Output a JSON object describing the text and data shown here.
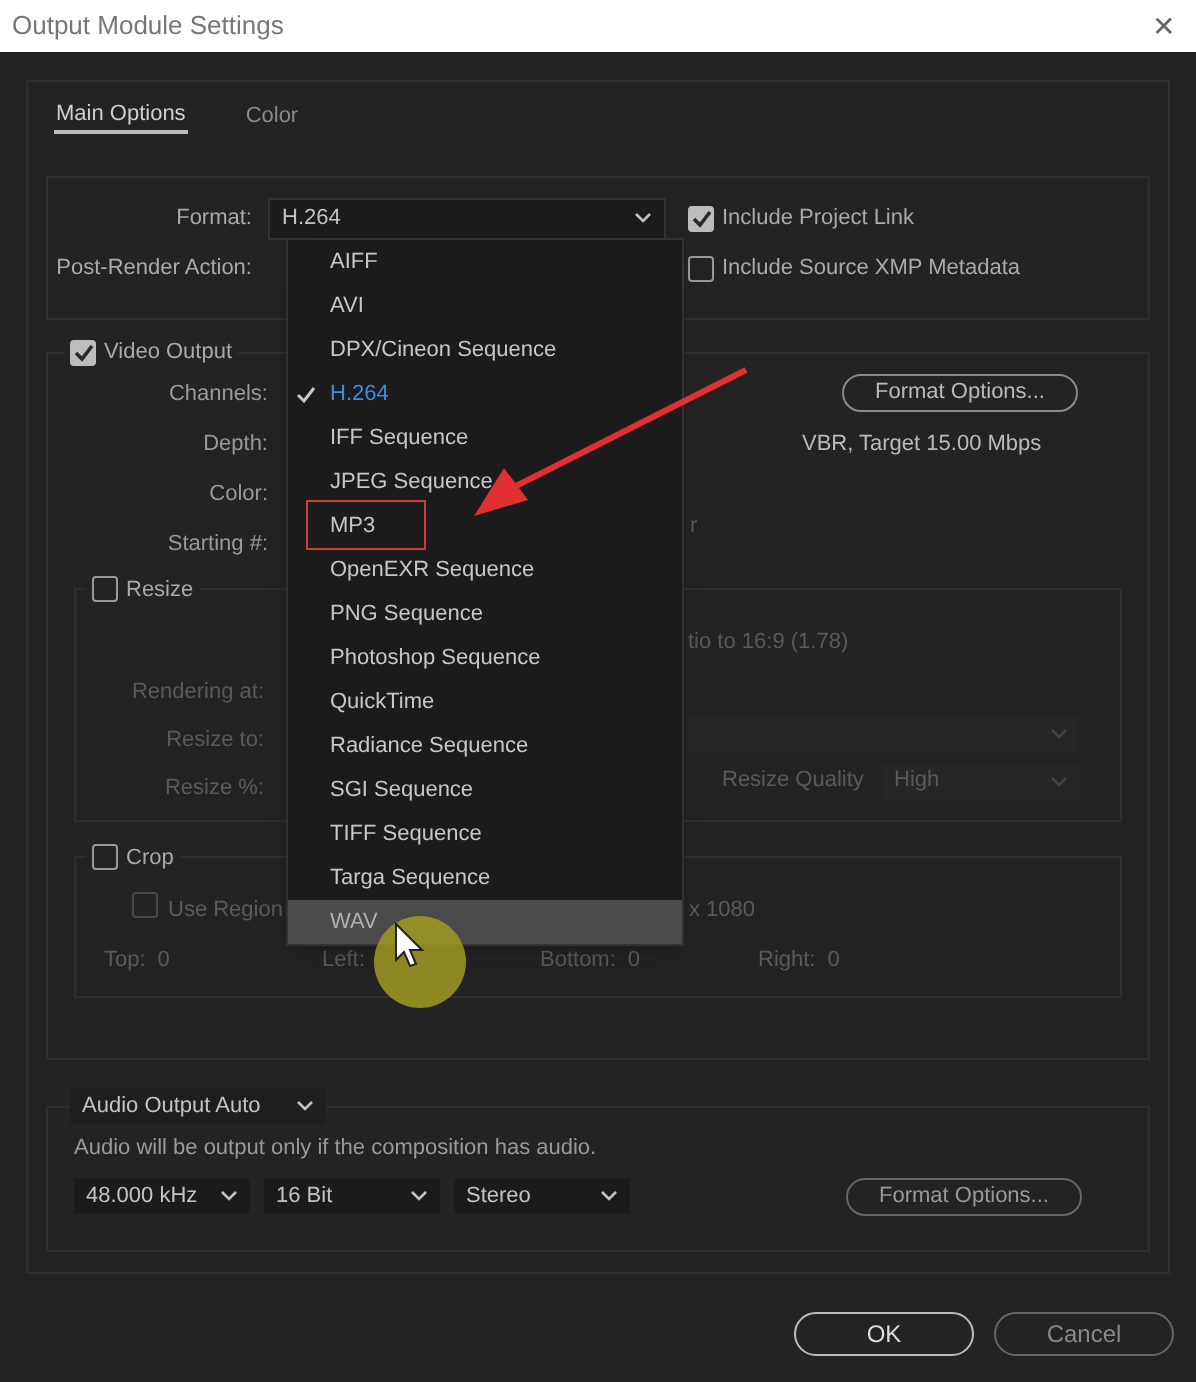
{
  "window": {
    "title": "Output Module Settings",
    "close": "✕"
  },
  "tabs": [
    {
      "label": "Main Options",
      "selected": true
    },
    {
      "label": "Color",
      "selected": false
    }
  ],
  "format": {
    "label": "Format:",
    "value": "H.264",
    "post_render_label": "Post-Render Action:"
  },
  "options": [
    {
      "label": "Include Project Link",
      "checked": true
    },
    {
      "label": "Include Source XMP Metadata",
      "checked": false
    }
  ],
  "video_output": {
    "label": "Video Output",
    "checked": true,
    "fields": [
      "Channels:",
      "Depth:",
      "Color:",
      "Starting #:"
    ],
    "format_options": "Format Options...",
    "bitrate": "VBR, Target 15.00 Mbps",
    "starting_suffix": "r"
  },
  "resize": {
    "label": "Resize",
    "checked": false,
    "fields": [
      "Rendering at:",
      "Resize to:",
      "Resize %:"
    ],
    "aspect_text": "tio to 16:9 (1.78)",
    "quality_label": "Resize Quality",
    "quality_value": "High"
  },
  "crop": {
    "label": "Crop",
    "checked": false,
    "use_region": {
      "label": "Use Region",
      "checked": false
    },
    "size_suffix": "x 1080",
    "edges": [
      {
        "label": "Top:",
        "value": "0"
      },
      {
        "label": "Left:"
      },
      {
        "label": "Bottom:",
        "value": "0"
      },
      {
        "label": "Right:",
        "value": "0"
      }
    ]
  },
  "format_menu": {
    "items": [
      {
        "label": "AIFF",
        "selected": false,
        "hovered": false,
        "marked": false
      },
      {
        "label": "AVI",
        "selected": false,
        "hovered": false,
        "marked": false
      },
      {
        "label": "DPX/Cineon Sequence",
        "selected": false,
        "hovered": false,
        "marked": false
      },
      {
        "label": "H.264",
        "selected": true,
        "hovered": false,
        "marked": false
      },
      {
        "label": "IFF Sequence",
        "selected": false,
        "hovered": false,
        "marked": false
      },
      {
        "label": "JPEG Sequence",
        "selected": false,
        "hovered": false,
        "marked": false
      },
      {
        "label": "MP3",
        "selected": false,
        "hovered": false,
        "marked": true
      },
      {
        "label": "OpenEXR Sequence",
        "selected": false,
        "hovered": false,
        "marked": false
      },
      {
        "label": "PNG Sequence",
        "selected": false,
        "hovered": false,
        "marked": false
      },
      {
        "label": "Photoshop Sequence",
        "selected": false,
        "hovered": false,
        "marked": false
      },
      {
        "label": "QuickTime",
        "selected": false,
        "hovered": false,
        "marked": false
      },
      {
        "label": "Radiance Sequence",
        "selected": false,
        "hovered": false,
        "marked": false
      },
      {
        "label": "SGI Sequence",
        "selected": false,
        "hovered": false,
        "marked": false
      },
      {
        "label": "TIFF Sequence",
        "selected": false,
        "hovered": false,
        "marked": false
      },
      {
        "label": "Targa Sequence",
        "selected": false,
        "hovered": false,
        "marked": false
      },
      {
        "label": "WAV",
        "selected": false,
        "hovered": true,
        "marked": false
      }
    ]
  },
  "audio": {
    "mode": "Audio Output Auto",
    "note": "Audio will be output only if the composition has audio.",
    "selects": [
      "48.000 kHz",
      "16 Bit",
      "Stereo"
    ],
    "format_options": "Format Options..."
  },
  "buttons": [
    {
      "label": "OK",
      "kind": "primary"
    },
    {
      "label": "Cancel",
      "kind": "secondary"
    }
  ]
}
